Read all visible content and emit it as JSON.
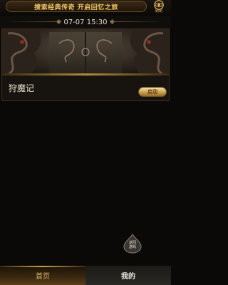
{
  "header": {
    "search_text": "搜索经典传奇 开启回忆之旅",
    "refresh_label": "刷新",
    "refresh_icon": "refresh-eye-icon"
  },
  "date_strip": {
    "datetime": "07-07 15:30"
  },
  "game": {
    "name": "狩魔记",
    "launch_label": "启动",
    "banner": "dragon-gate-banner"
  },
  "float_button": {
    "line1": "返回",
    "line2": "游戏"
  },
  "bottom_nav": {
    "tabs": [
      {
        "label": "首页",
        "active": true
      },
      {
        "label": "我的",
        "active": false
      }
    ]
  },
  "colors": {
    "accent_gold": "#c9a04e",
    "title_gold": "#f1c766",
    "background": "#0a0908"
  }
}
